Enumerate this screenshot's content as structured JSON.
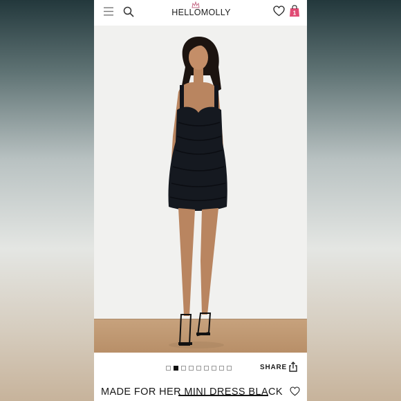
{
  "header": {
    "logo_text": "HELLOMOLLY",
    "icons": [
      "menu-icon",
      "search-icon",
      "wishlist-heart-icon",
      "shopping-bag-icon"
    ]
  },
  "bag": {
    "count": "1"
  },
  "gallery": {
    "image_count": 9,
    "active_index": 2
  },
  "share": {
    "label": "SHARE"
  },
  "product": {
    "title": "MADE FOR HER MINI DRESS BLACK"
  },
  "colors": {
    "bag_accent": "#e04b74",
    "text": "#161616"
  }
}
